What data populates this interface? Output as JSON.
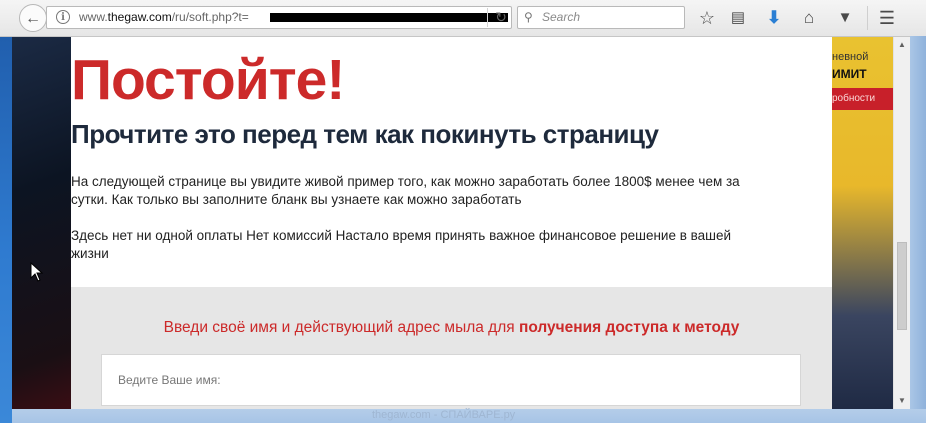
{
  "browser": {
    "url": {
      "prefix": "www.",
      "domain": "thegaw.com",
      "path": "/ru/soft.php?t="
    },
    "search_placeholder": "Search",
    "icons": [
      "back-icon",
      "info-icon",
      "reload-icon",
      "search-icon",
      "star-icon",
      "reading-list-icon",
      "download-icon",
      "home-icon",
      "pocket-icon",
      "menu-icon"
    ]
  },
  "background_page": {
    "right_line1": "невной",
    "right_line2": "ИМИТ",
    "right_button": "робности"
  },
  "popup": {
    "title": "Постойте!",
    "subtitle": "Прочтите это перед тем как покинуть страницу",
    "paragraph1": "На следующей странице вы увидите живой пример того, как можно заработать более 1800$ менее чем за сутки. Как только вы заполните бланк вы узнаете как можно заработать",
    "paragraph2": "Здесь нет ни одной оплаты Нет комиссий Настало время принять важное финансовое решение в вашей жизни",
    "form_heading_plain": "Введи своё имя и действующий адрес мыла для ",
    "form_heading_bold": "получения доступа к методу",
    "name_placeholder": "Ведите Ваше имя:"
  },
  "watermark": "thegaw.com - СПАЙВАРЕ.ру",
  "colors": {
    "title_red": "#cc2a2a",
    "subtitle_navy": "#1e2a3c",
    "form_bg": "#e6e6e6"
  }
}
